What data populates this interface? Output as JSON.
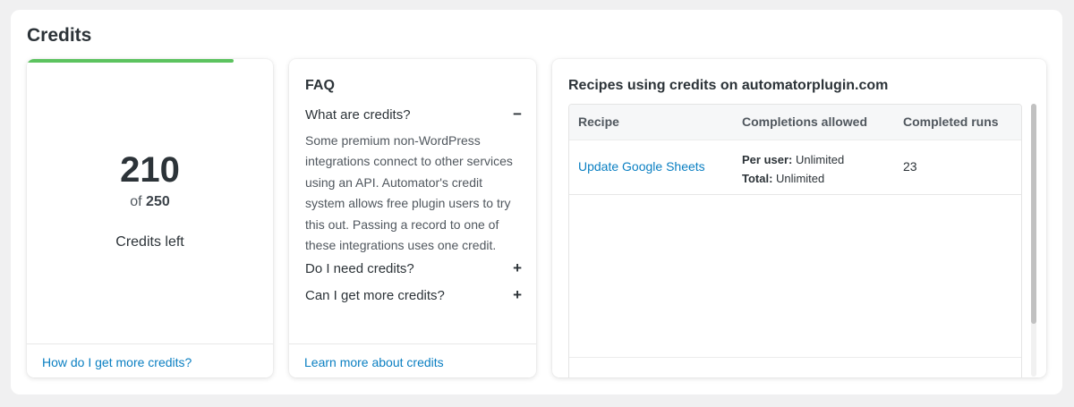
{
  "page": {
    "title": "Credits"
  },
  "credits": {
    "remaining": "210",
    "of_prefix": "of",
    "total": "250",
    "label": "Credits left",
    "progress_fraction": 0.84,
    "progress_color": "#5cc35f",
    "footer_link": "How do I get more credits?"
  },
  "faq": {
    "title": "FAQ",
    "items": [
      {
        "question": "What are credits?",
        "toggle": "−",
        "expanded": true,
        "answer": "Some premium non-WordPress integrations connect to other services using an API. Automator's credit system allows free plugin users to try this out. Passing a record to one of these integrations uses one credit."
      },
      {
        "question": "Do I need credits?",
        "toggle": "+",
        "expanded": false
      },
      {
        "question": "Can I get more credits?",
        "toggle": "+",
        "expanded": false
      }
    ],
    "footer_link": "Learn more about credits"
  },
  "recipes": {
    "title": "Recipes using credits on automatorplugin.com",
    "columns": [
      "Recipe",
      "Completions allowed",
      "Completed runs"
    ],
    "rows": [
      {
        "recipe": "Update Google Sheets",
        "per_user_label": "Per user:",
        "per_user_value": "Unlimited",
        "total_label": "Total:",
        "total_value": "Unlimited",
        "completed_runs": "23"
      }
    ]
  },
  "colors": {
    "link": "#0a7fc2",
    "accent_green": "#5cc35f"
  }
}
